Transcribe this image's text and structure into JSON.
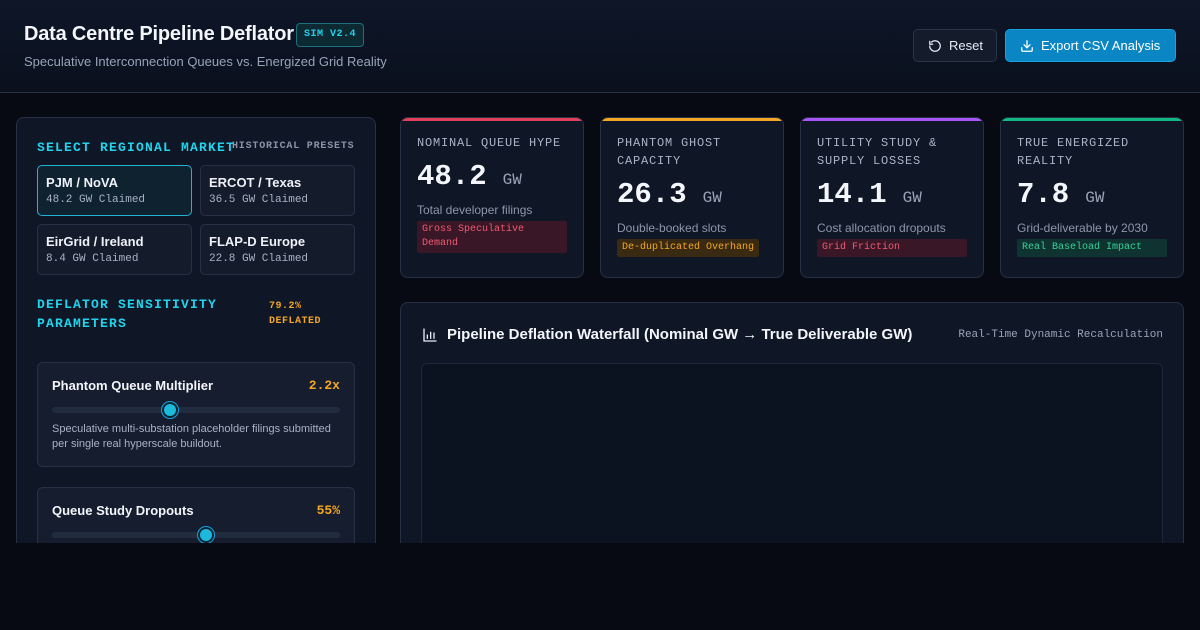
{
  "header": {
    "title": "Data Centre Pipeline Deflator",
    "badge": "SIM V2.4",
    "subtitle": "Speculative Interconnection Queues vs. Energized Grid Reality",
    "reset_label": "Reset",
    "export_label": "Export CSV Analysis"
  },
  "market": {
    "section_title": "SELECT REGIONAL MARKET",
    "presets_label": "HISTORICAL PRESETS",
    "items": [
      {
        "name": "PJM / NoVA",
        "claimed": "48.2 GW Claimed",
        "active": true
      },
      {
        "name": "ERCOT / Texas",
        "claimed": "36.5 GW Claimed",
        "active": false
      },
      {
        "name": "EirGrid / Ireland",
        "claimed": "8.4 GW Claimed",
        "active": false
      },
      {
        "name": "FLAP-D Europe",
        "claimed": "22.8 GW Claimed",
        "active": false
      }
    ]
  },
  "params": {
    "section_title_1": "DEFLATOR SENSITIVITY",
    "section_title_2": "PARAMETERS",
    "deflated_1": "79.2%",
    "deflated_2": "DEFLATED",
    "items": [
      {
        "label": "Phantom Queue Multiplier",
        "value": "2.2x",
        "level": 0.41,
        "desc": "Speculative multi-substation placeholder filings submitted per single real hyperscale buildout."
      },
      {
        "label": "Queue Study Dropouts",
        "value": "55%",
        "level": 0.535,
        "desc": ""
      }
    ]
  },
  "stats": [
    {
      "label": "NOMINAL QUEUE HYPE",
      "value": "48.2",
      "unit": "GW",
      "desc": "Total developer filings",
      "tag": "Gross Speculative Demand",
      "color": "#e0405a",
      "tag_bg": "#3a1726",
      "tag_fg": "#f05a74"
    },
    {
      "label": "PHANTOM GHOST CAPACITY",
      "value": "26.3",
      "unit": "GW",
      "desc": "Double-booked slots",
      "tag": "De-duplicated Overhang",
      "color": "#f5a623",
      "tag_bg": "#3a2a12",
      "tag_fg": "#f5a623"
    },
    {
      "label": "UTILITY STUDY & SUPPLY LOSSES",
      "value": "14.1",
      "unit": "GW",
      "desc": "Cost allocation dropouts",
      "tag": "Grid Friction",
      "color": "#a855f7",
      "tag_bg": "#3a1726",
      "tag_fg": "#f05a74"
    },
    {
      "label": "TRUE ENERGIZED REALITY",
      "value": "7.8",
      "unit": "GW",
      "desc": "Grid-deliverable by 2030",
      "tag": "Real Baseload Impact",
      "color": "#10b981",
      "tag_bg": "#0f3330",
      "tag_fg": "#34d399"
    }
  ],
  "waterfall": {
    "title": "Pipeline Deflation Waterfall (Nominal GW → True Deliverable GW)",
    "subtitle": "Real-Time Dynamic Recalculation"
  }
}
